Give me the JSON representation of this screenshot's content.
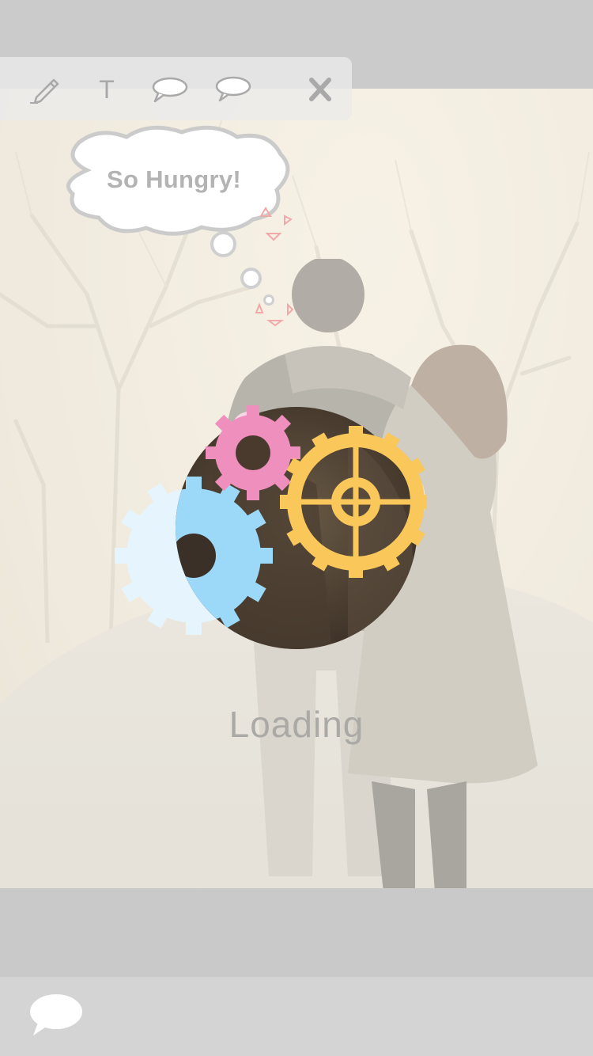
{
  "toolbar": {
    "items": [
      {
        "name": "pencil",
        "icon": "pencil-icon"
      },
      {
        "name": "text",
        "label": "T"
      },
      {
        "name": "speech-bubble",
        "icon": "speech-bubble-icon"
      },
      {
        "name": "thought-bubble",
        "icon": "thought-bubble-icon"
      },
      {
        "name": "close",
        "icon": "close-icon"
      }
    ]
  },
  "canvas": {
    "thought_bubble_text": "So Hungry!"
  },
  "loading": {
    "text": "Loading",
    "gear_colors": {
      "pink": "#ef8fbd",
      "yellow": "#f9c75a",
      "blue": "#9cd8f8",
      "pale_blue": "#e6f4fd"
    }
  },
  "bottom_bar": {
    "chat_icon": "chat-bubble-icon"
  }
}
